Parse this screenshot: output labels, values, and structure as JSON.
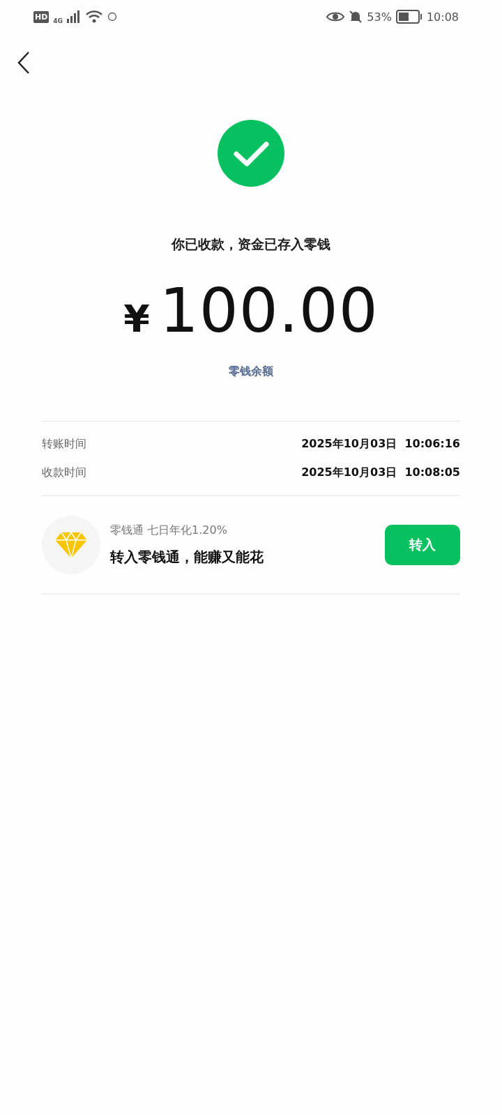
{
  "status_bar": {
    "hd": "HD",
    "network": "4G",
    "battery_percent": "53%",
    "time": "10:08"
  },
  "result": {
    "message": "你已收款，资金已存入零钱",
    "currency": "¥",
    "amount": "100.00",
    "balance_link": "零钱余额"
  },
  "details": [
    {
      "label": "转账时间",
      "value": "2025年10月03日  10:06:16"
    },
    {
      "label": "收款时间",
      "value": "2025年10月03日  10:08:05"
    }
  ],
  "promo": {
    "name": "零钱通",
    "rate": "七日年化1.20%",
    "headline": "转入零钱通，能赚又能花",
    "button": "转入"
  }
}
